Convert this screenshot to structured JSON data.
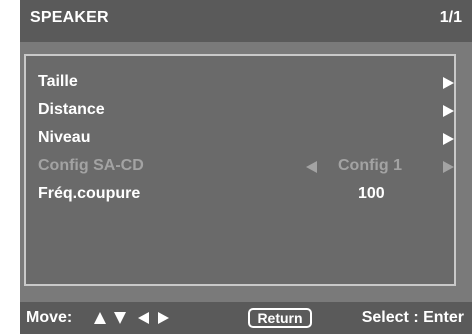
{
  "header": {
    "title": "SPEAKER",
    "page": "1/1"
  },
  "menu": {
    "items": [
      {
        "label": "Taille",
        "enabled": true,
        "arrow": "right-arrow-icon"
      },
      {
        "label": "Distance",
        "enabled": true,
        "arrow": "right-arrow-icon"
      },
      {
        "label": "Niveau",
        "enabled": true,
        "arrow": "right-arrow-icon"
      },
      {
        "label": "Config SA-CD",
        "enabled": false,
        "value": "Config 1",
        "arrows": [
          "left-arrow-icon",
          "right-arrow-icon"
        ]
      },
      {
        "label": "Fréq.coupure",
        "enabled": true,
        "value": "100"
      }
    ]
  },
  "footer": {
    "move_label": "Move:",
    "move_icons": [
      "up-arrow-icon",
      "down-arrow-icon",
      "left-arrow-icon",
      "right-arrow-icon"
    ],
    "return_label": "Return",
    "select_label": "Select : Enter"
  },
  "colors": {
    "header_bg": "#5a5a5a",
    "body_bg": "#7a7a7a",
    "panel_bg": "#6a6a6a",
    "panel_border": "#c9c9c9",
    "text": "#ffffff",
    "disabled_text": "#a3a3a3"
  }
}
